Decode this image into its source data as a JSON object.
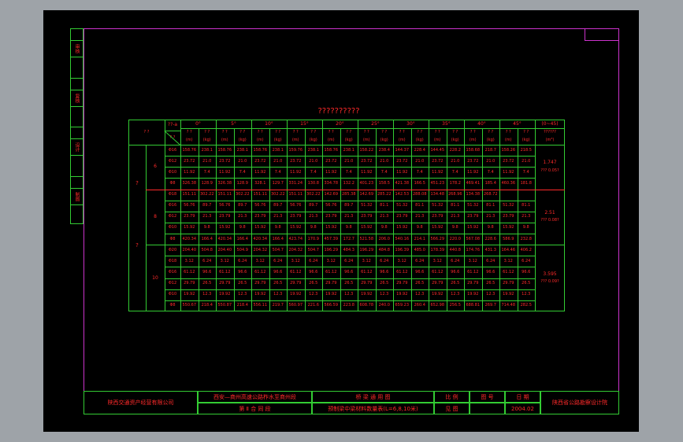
{
  "colors": {
    "background": "#9ea3a8",
    "sheet": "#000000",
    "frame": "#cc33cc",
    "grid": "#33cc33",
    "text": "#ff2a2a"
  },
  "side_labels": [
    "审核",
    "复核",
    "设计",
    "制图"
  ],
  "table": {
    "title": "??????????",
    "header": {
      "corner_top": "??-a",
      "corner_left": "? ?",
      "corner_sub": "? ?",
      "angles": [
        "0°",
        "5°",
        "10°",
        "15°",
        "20°",
        "25°",
        "30°",
        "35°",
        "40°",
        "45°"
      ],
      "sub_cols": [
        "(m)",
        "(kg)"
      ],
      "last_col_title": "(0~45)",
      "last_col_sub": "??????",
      "last_col_unit": "(m³)"
    },
    "group_label_top": "?",
    "group_label_bottom": "?",
    "sections": [
      {
        "span": "6",
        "rows": [
          {
            "bar": "Φ16",
            "values": [
              "158.76",
              "238.1",
              "158.76",
              "238.1",
              "158.76",
              "238.1",
              "159.76",
              "238.1",
              "158.76",
              "238.1",
              "158.22",
              "238.4",
              "144.37",
              "228.4",
              "144.45",
              "228.2",
              "158.68",
              "218.7",
              "158.26",
              "218.5"
            ]
          },
          {
            "bar": "Φ12",
            "values": [
              "23.72",
              "21.0",
              "23.72",
              "21.0",
              "23.72",
              "21.0",
              "23.72",
              "21.0",
              "23.72",
              "21.0",
              "23.72",
              "21.0",
              "23.72",
              "21.0",
              "23.72",
              "21.0",
              "23.72",
              "21.0",
              "23.72",
              "21.0"
            ]
          },
          {
            "bar": "Φ10",
            "values": [
              "11.92",
              "7.4",
              "11.92",
              "7.4",
              "11.92",
              "7.4",
              "11.92",
              "7.4",
              "11.92",
              "7.4",
              "11.92",
              "7.4",
              "11.92",
              "7.4",
              "11.92",
              "7.4",
              "11.92",
              "7.4",
              "11.92",
              "7.4"
            ]
          },
          {
            "bar": "Φ8",
            "values": [
              "326.38",
              "128.9",
              "326.38",
              "128.9",
              "328.1",
              "129.7",
              "331.24",
              "130.8",
              "334.78",
              "132.2",
              "401.23",
              "158.5",
              "421.38",
              "166.5",
              "451.23",
              "178.2",
              "469.41",
              "185.4",
              "460.36",
              "181.8"
            ]
          }
        ],
        "volume": "1.747",
        "volume_note": "??? 0.05?"
      },
      {
        "span": "8",
        "rows": [
          {
            "bar": "Φ18",
            "values": [
              "151.11",
              "302.22",
              "151.11",
              "302.22",
              "151.11",
              "302.22",
              "151.11",
              "302.22",
              "142.69",
              "285.38",
              "142.69",
              "285.22",
              "142.53",
              "288.08",
              "134.48",
              "268.96",
              "134.38",
              "268.72"
            ]
          },
          {
            "bar": "Φ16",
            "values": [
              "56.76",
              "89.7",
              "56.76",
              "89.7",
              "56.76",
              "89.7",
              "56.76",
              "89.7",
              "56.76",
              "89.7",
              "51.32",
              "81.1",
              "51.32",
              "81.1",
              "51.32",
              "81.1",
              "51.32",
              "81.1",
              "51.32",
              "81.1"
            ]
          },
          {
            "bar": "Φ12",
            "values": [
              "23.79",
              "21.3",
              "23.79",
              "21.3",
              "23.79",
              "21.3",
              "23.79",
              "21.3",
              "23.79",
              "21.3",
              "23.79",
              "21.3",
              "23.79",
              "21.3",
              "23.79",
              "21.3",
              "23.79",
              "21.3",
              "23.79",
              "21.3"
            ]
          },
          {
            "bar": "Φ10",
            "values": [
              "15.92",
              "9.8",
              "15.92",
              "9.8",
              "15.92",
              "9.8",
              "15.92",
              "9.8",
              "15.92",
              "9.8",
              "15.92",
              "9.8",
              "15.92",
              "9.8",
              "15.92",
              "9.8",
              "15.92",
              "9.8",
              "15.92",
              "9.8"
            ]
          },
          {
            "bar": "Φ8",
            "values": [
              "420.34",
              "166.4",
              "420.34",
              "166.4",
              "420.34",
              "166.4",
              "423.74",
              "170.9",
              "457.39",
              "172.7",
              "521.58",
              "206.0",
              "540.16",
              "214.1",
              "566.29",
              "220.0",
              "567.08",
              "228.6",
              "586.9",
              "232.8"
            ]
          }
        ],
        "volume": "2.51",
        "volume_note": "??? 0.08?"
      },
      {
        "span": "10",
        "rows": [
          {
            "bar": "Φ20",
            "values": [
              "204.40",
              "504.8",
              "204.40",
              "504.9",
              "204.32",
              "504.7",
              "204.32",
              "504.7",
              "196.29",
              "484.3",
              "196.29",
              "484.8",
              "196.39",
              "485.0",
              "178.39",
              "440.8",
              "174.76",
              "431.3",
              "164.46",
              "406.2"
            ]
          },
          {
            "bar": "Φ18",
            "values": [
              "3.12",
              "6.24",
              "3.12",
              "6.24",
              "3.12",
              "6.24",
              "3.12",
              "6.24",
              "3.12",
              "6.24",
              "3.12",
              "6.24",
              "3.12",
              "6.24",
              "3.12",
              "6.24",
              "3.12",
              "6.24",
              "3.12",
              "6.24"
            ]
          },
          {
            "bar": "Φ16",
            "values": [
              "61.12",
              "96.6",
              "61.12",
              "96.6",
              "61.12",
              "96.6",
              "61.12",
              "96.6",
              "61.12",
              "96.6",
              "61.12",
              "96.6",
              "61.12",
              "96.6",
              "61.12",
              "96.6",
              "61.12",
              "96.6",
              "61.12",
              "96.6"
            ]
          },
          {
            "bar": "Φ12",
            "values": [
              "29.79",
              "26.5",
              "29.79",
              "26.5",
              "29.79",
              "26.5",
              "29.79",
              "26.5",
              "29.79",
              "26.5",
              "29.79",
              "26.5",
              "29.79",
              "26.5",
              "29.79",
              "26.5",
              "29.79",
              "26.5",
              "29.79",
              "26.5"
            ]
          },
          {
            "bar": "Φ10",
            "values": [
              "19.92",
              "12.3",
              "19.92",
              "12.3",
              "19.92",
              "12.3",
              "19.92",
              "12.3",
              "19.92",
              "12.3",
              "19.92",
              "12.3",
              "19.92",
              "12.3",
              "19.92",
              "12.3",
              "19.92",
              "12.3",
              "19.92",
              "12.3"
            ]
          },
          {
            "bar": "Φ8",
            "values": [
              "550.67",
              "218.4",
              "550.87",
              "218.4",
              "556.11",
              "219.7",
              "560.97",
              "221.6",
              "566.59",
              "223.8",
              "608.78",
              "240.0",
              "659.23",
              "260.4",
              "652.98",
              "256.5",
              "688.81",
              "269.7",
              "714.48",
              "282.5"
            ]
          }
        ],
        "volume": "3.595",
        "volume_note": "??? 0.09?"
      }
    ]
  },
  "title_block": {
    "company": "陕西交通资产经营有限公司",
    "project_line1": "西安—商州高速公路柞水至商州段",
    "project_line2": "第 Ⅱ 合 同 段",
    "drawing_line1": "桥 梁 通 用 图",
    "drawing_line2": "预制梁中梁材料数量表(L=6,8,10米)",
    "labels": [
      "比 例",
      "图 号",
      "日 期"
    ],
    "scale_value": "见 图",
    "drawing_no": "",
    "date": "2004.02",
    "institute": "陕西省公路勘察设计院"
  }
}
